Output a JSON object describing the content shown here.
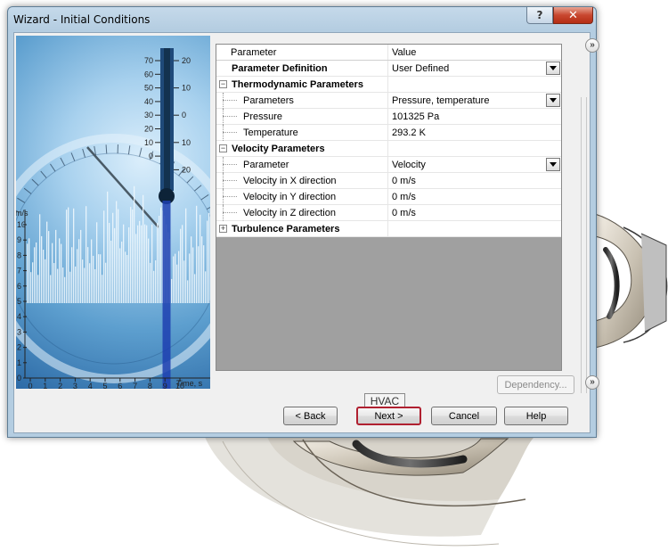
{
  "window": {
    "title": "Wizard - Initial Conditions",
    "help_glyph": "?",
    "close_glyph": "✕"
  },
  "illustration": {
    "thermometer_ticks_left": [
      "70",
      "60",
      "50",
      "40",
      "30",
      "20",
      "10",
      "0"
    ],
    "thermometer_ticks_right": [
      "20",
      "10",
      "0",
      "10",
      "20"
    ],
    "y_axis_unit": "m/s",
    "y_ticks": [
      "10",
      "9",
      "8",
      "7",
      "6",
      "5",
      "4",
      "3",
      "2",
      "1",
      "0"
    ],
    "x_ticks": [
      "0",
      "1",
      "2",
      "3",
      "4",
      "5",
      "6",
      "7",
      "8",
      "9",
      "10"
    ],
    "x_axis_label": "Time, s"
  },
  "grid": {
    "header": {
      "parameter": "Parameter",
      "value": "Value"
    },
    "rows": [
      {
        "label": "Parameter Definition",
        "value": "User Defined",
        "kind": "bold",
        "dropdown": true
      },
      {
        "label": "Thermodynamic Parameters",
        "value": "",
        "kind": "group",
        "expander": "−"
      },
      {
        "label": "Parameters",
        "value": "Pressure, temperature",
        "kind": "child",
        "dropdown": true
      },
      {
        "label": "Pressure",
        "value": "101325 Pa",
        "kind": "child"
      },
      {
        "label": "Temperature",
        "value": "293.2 K",
        "kind": "child"
      },
      {
        "label": "Velocity Parameters",
        "value": "",
        "kind": "group",
        "expander": "−"
      },
      {
        "label": "Parameter",
        "value": "Velocity",
        "kind": "child",
        "dropdown": true
      },
      {
        "label": "Velocity in X direction",
        "value": "0 m/s",
        "kind": "child"
      },
      {
        "label": "Velocity in Y direction",
        "value": "0 m/s",
        "kind": "child"
      },
      {
        "label": "Velocity in Z direction",
        "value": "0 m/s",
        "kind": "child"
      },
      {
        "label": "Turbulence Parameters",
        "value": "",
        "kind": "group",
        "expander": "+"
      }
    ]
  },
  "side_controls": {
    "collapse_glyph": "»",
    "expand_glyph": "»"
  },
  "buttons": {
    "dependency": "Dependency...",
    "hvac": "HVAC",
    "back": "< Back",
    "next": "Next >",
    "cancel": "Cancel",
    "help": "Help"
  },
  "colors": {
    "default_button_border": "#b02030",
    "close_button": "#c8472f",
    "title_bar": "#b4cde1"
  }
}
